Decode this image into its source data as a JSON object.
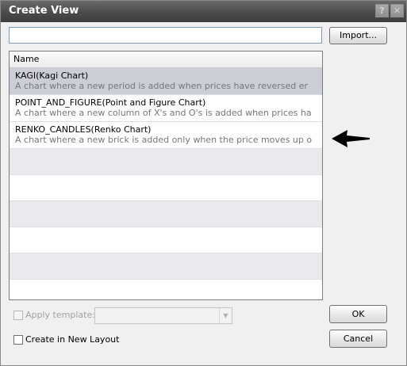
{
  "window": {
    "title": "Create View",
    "help_glyph": "?",
    "close_glyph": "✕"
  },
  "name_input": {
    "value": ""
  },
  "import_button": {
    "label": "Import..."
  },
  "list": {
    "column_header": "Name",
    "items": [
      {
        "title": "KAGI(Kagi Chart)",
        "description": "A chart where a new period is added when prices have reversed er",
        "selected": true
      },
      {
        "title": "POINT_AND_FIGURE(Point and Figure Chart)",
        "description": "A chart where a new column of X's and O's is added when prices ha",
        "selected": false
      },
      {
        "title": "RENKO_CANDLES(Renko Chart)",
        "description": "A chart where a new brick is added only when the price moves up o",
        "selected": false
      }
    ],
    "empty_rows": 5
  },
  "apply_template": {
    "label": "Apply template:",
    "checked": false,
    "enabled": false,
    "selected_value": ""
  },
  "create_in_new_layout": {
    "label": "Create in New Layout",
    "checked": false
  },
  "ok_button": {
    "label": "OK"
  },
  "cancel_button": {
    "label": "Cancel"
  },
  "annotation": {
    "icon": "left-arrow-icon",
    "color": "#000000"
  }
}
